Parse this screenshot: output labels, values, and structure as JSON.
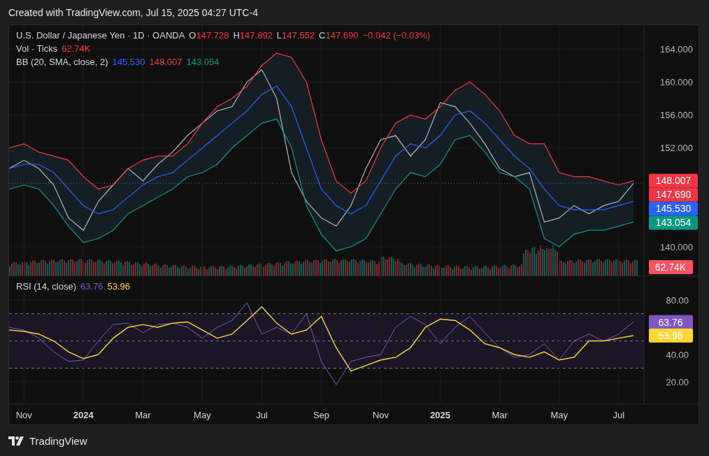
{
  "header": {
    "caption": "Created with TradingView.com, Jul 15, 2025 04:27 UTC-4"
  },
  "price_pane": {
    "legend": {
      "ohlc": [
        {
          "key": "O",
          "value": "147.728"
        },
        {
          "key": "H",
          "value": "147.892"
        },
        {
          "key": "L",
          "value": "147.552"
        },
        {
          "key": "C",
          "value": "147.690"
        }
      ],
      "change": "−0.042 (−0.03%)"
    },
    "volume_legend": {
      "label": "Vol · Ticks",
      "value": "62.74K"
    },
    "bb_legend": {
      "label": "BB (20, SMA, close, 2)",
      "values": [
        {
          "text": "145.530",
          "color": "#2962ff"
        },
        {
          "text": "148.007",
          "color": "#f23645"
        },
        {
          "text": "143.054",
          "color": "#089981"
        }
      ]
    },
    "chart_data": {
      "type": "line",
      "grid": true,
      "categories": [
        null,
        null,
        null,
        null,
        null,
        null,
        null,
        null,
        null,
        null,
        null,
        null,
        null,
        null,
        null,
        null,
        null,
        null,
        null,
        null,
        null,
        null,
        null,
        null,
        null,
        null,
        null,
        null,
        null,
        null,
        null,
        null,
        null,
        null,
        null,
        null,
        null,
        null,
        null,
        null,
        null,
        null,
        null
      ],
      "series": [
        {
          "name": "U.S. Dollar / Japanese Yen · 1D · OANDA",
          "color": "#b2b5be",
          "values": [
            149.5,
            150.5,
            149.5,
            147.5,
            143.5,
            142,
            145.5,
            147.5,
            149.5,
            148,
            150,
            151.5,
            153.5,
            155,
            156.5,
            157,
            160,
            161.5,
            158,
            149,
            145.5,
            143.5,
            142.5,
            145,
            149.5,
            153,
            153.5,
            151,
            153,
            157.5,
            157,
            155,
            152.5,
            149.5,
            148.5,
            149,
            143,
            143.5,
            145,
            144,
            145,
            145.5,
            147.7
          ]
        },
        {
          "color": "#2962ff",
          "values": [
            149.5,
            150,
            150,
            149,
            147,
            145,
            144,
            144.5,
            146,
            147.5,
            148.5,
            149,
            150.5,
            152,
            153.5,
            155,
            156.5,
            158.5,
            159.5,
            157,
            152,
            147,
            145,
            144,
            145,
            148,
            151,
            152.5,
            152,
            153.5,
            156,
            156.5,
            155,
            153,
            151,
            149.5,
            147,
            145,
            144.5,
            144.5,
            144.5,
            145,
            145.5
          ]
        },
        {
          "color": "#f23645",
          "values": [
            152,
            152.5,
            151.5,
            151,
            150.5,
            148.5,
            147,
            147.5,
            149.5,
            150.5,
            151,
            151,
            152.5,
            155,
            157,
            158,
            159.5,
            162,
            163.5,
            163,
            160,
            153,
            148,
            146.5,
            148,
            152,
            155,
            156,
            155.5,
            157,
            159,
            160,
            158.5,
            156.5,
            153.5,
            152.5,
            152.5,
            149,
            148.5,
            148.5,
            148,
            147.5,
            148
          ]
        },
        {
          "color": "#089981",
          "values": [
            147,
            147.5,
            147,
            145,
            142.5,
            140.5,
            141,
            142,
            144,
            145,
            146,
            147,
            148.5,
            149,
            150,
            152,
            153.5,
            155,
            155.5,
            152,
            145,
            141.5,
            139.5,
            140,
            141,
            144,
            147,
            149,
            148.5,
            150,
            153,
            153.5,
            151.5,
            149,
            148.5,
            147,
            141,
            140,
            141.5,
            142,
            142,
            142.5,
            143
          ]
        }
      ],
      "ylim": [
        136.5,
        166.9
      ],
      "yticks": [
        {
          "value": 140,
          "label": "140.000"
        },
        {
          "value": 152,
          "label": "152.000"
        },
        {
          "value": 156,
          "label": "156.000"
        },
        {
          "value": 160,
          "label": "160.000"
        },
        {
          "value": 164,
          "label": "164.000"
        }
      ]
    },
    "price_labels": [
      {
        "kind": "price",
        "text": "148.007",
        "color": "#f23645"
      },
      {
        "kind": "price",
        "text": "147.690",
        "color": "#f23645"
      },
      {
        "kind": "price",
        "text": "145.530",
        "color": "#2962ff"
      },
      {
        "kind": "price",
        "text": "143.054",
        "color": "#089981"
      },
      {
        "kind": "volume",
        "text": "62.74K",
        "color": "#f7525f"
      }
    ]
  },
  "rsi_pane": {
    "legend": {
      "values": [
        {
          "text": "63.76",
          "color": "#7e57c2"
        },
        {
          "text": "53.96",
          "color": "#fdd835"
        }
      ]
    },
    "chart_data": {
      "type": "line",
      "grid": true,
      "categories": [
        null,
        "Nov",
        null,
        null,
        null,
        "2024",
        null,
        null,
        null,
        "Mar",
        null,
        null,
        null,
        "May",
        null,
        null,
        null,
        "Jul",
        null,
        null,
        null,
        "Sep",
        null,
        null,
        null,
        "Nov",
        null,
        null,
        null,
        "2025",
        null,
        null,
        null,
        "Mar",
        null,
        null,
        null,
        "May",
        null,
        null,
        null,
        "Jul",
        null
      ],
      "series": [
        {
          "name": "RSI (14, close)",
          "color": "#7e57c2",
          "values": [
            60,
            58,
            52,
            42,
            35,
            36,
            50,
            62,
            63,
            56,
            62,
            63,
            60,
            52,
            60,
            65,
            78,
            55,
            60,
            55,
            70,
            35,
            18,
            35,
            38,
            40,
            60,
            68,
            62,
            48,
            60,
            68,
            56,
            45,
            38,
            40,
            48,
            36,
            50,
            55,
            50,
            55,
            64
          ]
        },
        {
          "color": "#fdd835",
          "values": [
            58,
            57,
            55,
            50,
            42,
            37,
            40,
            52,
            60,
            62,
            60,
            63,
            64,
            58,
            52,
            55,
            65,
            75,
            63,
            55,
            58,
            68,
            45,
            28,
            32,
            36,
            38,
            45,
            60,
            66,
            65,
            58,
            48,
            45,
            40,
            38,
            42,
            36,
            38,
            50,
            50,
            52,
            54
          ]
        }
      ],
      "ylim": [
        4.1,
        97.4
      ],
      "yticks": [
        {
          "value": 20,
          "label": "20.00"
        },
        {
          "value": 40,
          "label": "40.00"
        },
        {
          "value": 80,
          "label": "80.00"
        }
      ]
    },
    "value_labels": [
      {
        "text": "63.76",
        "color": "#7e57c2"
      },
      {
        "text": "53.96",
        "color": "#fdd835"
      }
    ]
  },
  "footer": {
    "brand": "TradingView"
  }
}
